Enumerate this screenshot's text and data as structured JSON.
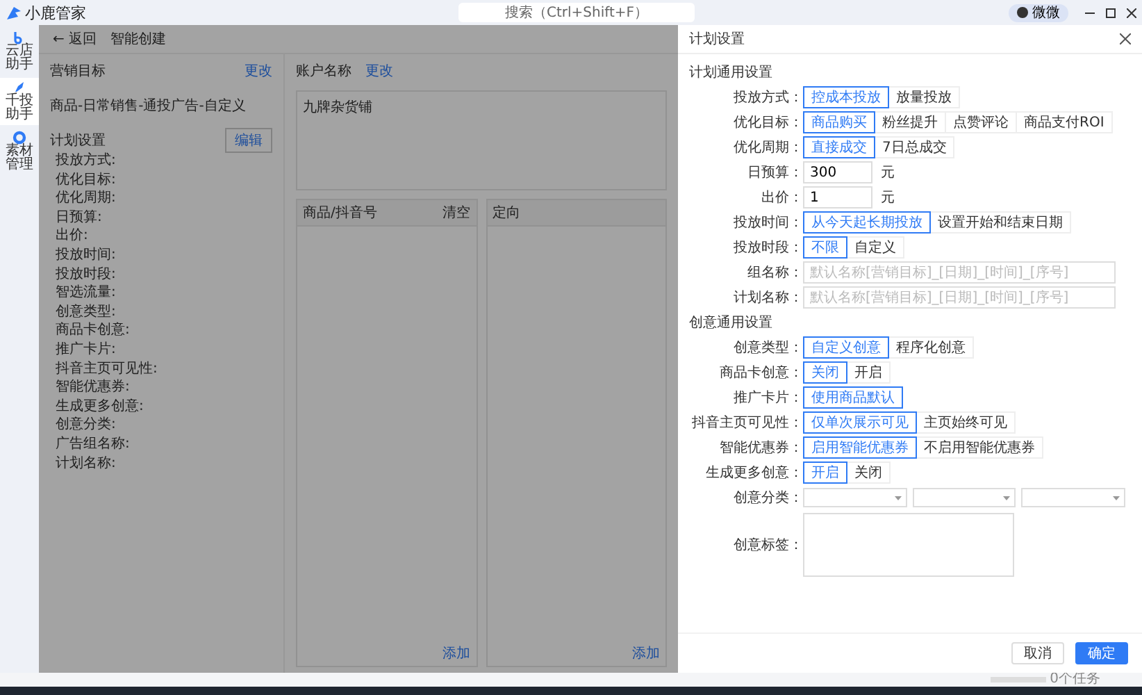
{
  "top_bar": {
    "app_name": "小鹿管家",
    "search": {
      "placeholder": "搜索（Ctrl+Shift+F）"
    },
    "user": "微微"
  },
  "nav": [
    {
      "label": "云店助手",
      "selected": false
    },
    {
      "label": "千投助手",
      "selected": true
    },
    {
      "label": "素材管理",
      "selected": false
    }
  ],
  "page": {
    "back": "← 返回",
    "title": "智能创建",
    "marketing": {
      "title": "营销目标",
      "action": "更改",
      "summary": "商品-日常销售-通投广告-自定义"
    },
    "plan": {
      "title": "计划设置",
      "action": "编辑",
      "fields": [
        "投放方式:",
        "优化目标:",
        "优化周期:",
        "日预算:",
        "出价:",
        "投放时间:",
        "投放时段:",
        "智选流量:",
        "创意类型:",
        "商品卡创意:",
        "推广卡片:",
        "抖音主页可见性:",
        "智能优惠券:",
        "生成更多创意:",
        "创意分类:",
        "广告组名称:",
        "计划名称:"
      ]
    },
    "account": {
      "label": "账户名称",
      "action": "更改",
      "value": "九牌杂货铺"
    },
    "panels": [
      {
        "title": "商品/抖音号",
        "action": "清空",
        "add": "添加"
      },
      {
        "title": "定向",
        "add": "添加"
      }
    ]
  },
  "drawer": {
    "title": "计划设置",
    "sections": [
      {
        "title": "计划通用设置",
        "rows": [
          {
            "kind": "options",
            "label": "投放方式：",
            "options": [
              {
                "label": "控成本投放",
                "selected": true
              },
              {
                "label": "放量投放",
                "selected": false
              }
            ]
          },
          {
            "kind": "options",
            "label": "优化目标：",
            "options": [
              {
                "label": "商品购买",
                "selected": true
              },
              {
                "label": "粉丝提升",
                "selected": false
              },
              {
                "label": "点赞评论",
                "selected": false
              },
              {
                "label": "商品支付ROI",
                "selected": false
              }
            ]
          },
          {
            "kind": "options",
            "label": "优化周期：",
            "options": [
              {
                "label": "直接成交",
                "selected": true
              },
              {
                "label": "7日总成交",
                "selected": false
              }
            ]
          },
          {
            "kind": "amount",
            "label": "日预算：",
            "value": "300",
            "unit": "元"
          },
          {
            "kind": "amount",
            "label": "出价：",
            "value": "1",
            "unit": "元"
          },
          {
            "kind": "options",
            "label": "投放时间：",
            "options": [
              {
                "label": "从今天起长期投放",
                "selected": true
              },
              {
                "label": "设置开始和结束日期",
                "selected": false
              }
            ]
          },
          {
            "kind": "options",
            "label": "投放时段：",
            "options": [
              {
                "label": "不限",
                "selected": true
              },
              {
                "label": "自定义",
                "selected": false
              }
            ]
          },
          {
            "kind": "text",
            "label": "组名称：",
            "placeholder": "默认名称[营销目标]_[日期]_[时间]_[序号]"
          },
          {
            "kind": "text",
            "label": "计划名称：",
            "placeholder": "默认名称[营销目标]_[日期]_[时间]_[序号]"
          }
        ]
      },
      {
        "title": "创意通用设置",
        "rows": [
          {
            "kind": "options",
            "label": "创意类型：",
            "options": [
              {
                "label": "自定义创意",
                "selected": true
              },
              {
                "label": "程序化创意",
                "selected": false
              }
            ]
          },
          {
            "kind": "options",
            "label": "商品卡创意：",
            "options": [
              {
                "label": "关闭",
                "selected": true
              },
              {
                "label": "开启",
                "selected": false
              }
            ]
          },
          {
            "kind": "options",
            "label": "推广卡片：",
            "options": [
              {
                "label": "使用商品默认",
                "selected": true
              }
            ]
          },
          {
            "kind": "options",
            "label": "抖音主页可见性：",
            "options": [
              {
                "label": "仅单次展示可见",
                "selected": true
              },
              {
                "label": "主页始终可见",
                "selected": false
              }
            ]
          },
          {
            "kind": "options",
            "label": "智能优惠券：",
            "options": [
              {
                "label": "启用智能优惠券",
                "selected": true
              },
              {
                "label": "不启用智能优惠券",
                "selected": false
              }
            ]
          },
          {
            "kind": "options",
            "label": "生成更多创意：",
            "options": [
              {
                "label": "开启",
                "selected": true
              },
              {
                "label": "关闭",
                "selected": false
              }
            ]
          },
          {
            "kind": "selects",
            "label": "创意分类："
          },
          {
            "kind": "textarea",
            "label": "创意标签："
          }
        ]
      }
    ],
    "buttons": [
      {
        "label": "取消",
        "primary": false
      },
      {
        "label": "确定",
        "primary": true
      }
    ]
  },
  "status_bar": {
    "level": 0,
    "tasks": "0个任务"
  }
}
